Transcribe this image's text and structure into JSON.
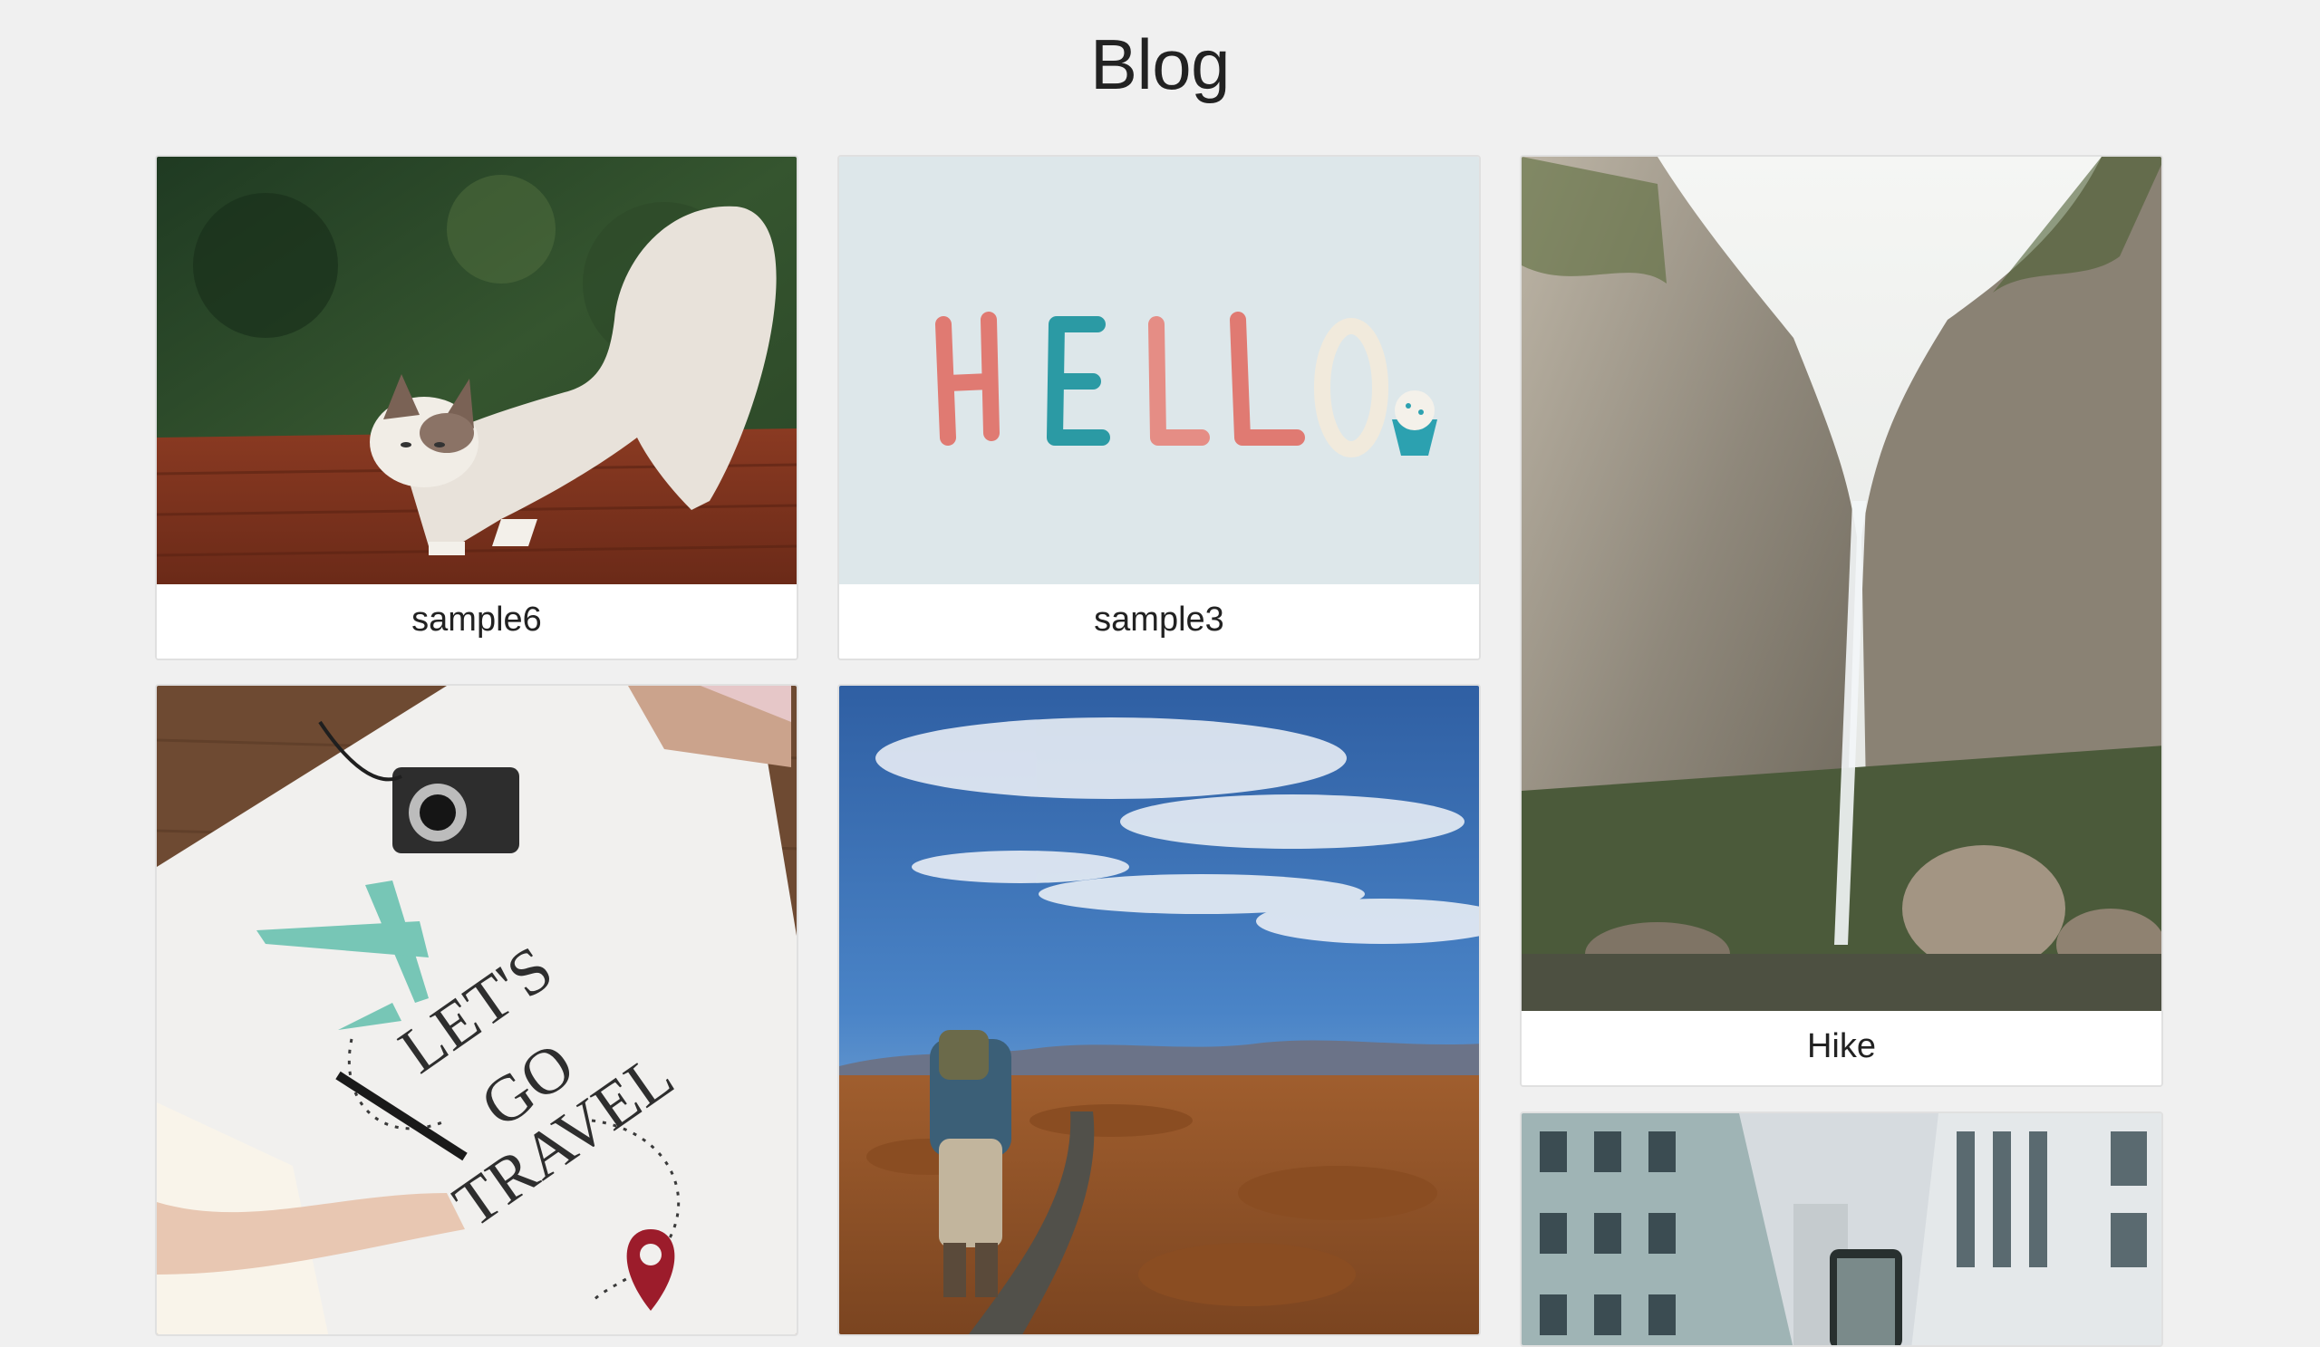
{
  "page": {
    "title": "Blog"
  },
  "posts": [
    {
      "caption": "sample6",
      "image": "cat-stretching-photo"
    },
    {
      "caption": "sample3",
      "image": "hello-clay-letters-photo"
    },
    {
      "caption": "Hike",
      "image": "waterfall-cliff-photo"
    },
    {
      "caption": "",
      "image": "lets-go-travel-map-photo",
      "overlay_text": [
        "LET'S",
        "GO",
        "TRAVEL"
      ]
    },
    {
      "caption": "",
      "image": "hiker-mountain-sky-photo"
    },
    {
      "caption": "",
      "image": "city-buildings-phone-photo"
    }
  ],
  "colors": {
    "background": "#f0f0f0",
    "card": "#ffffff",
    "text": "#222222"
  }
}
